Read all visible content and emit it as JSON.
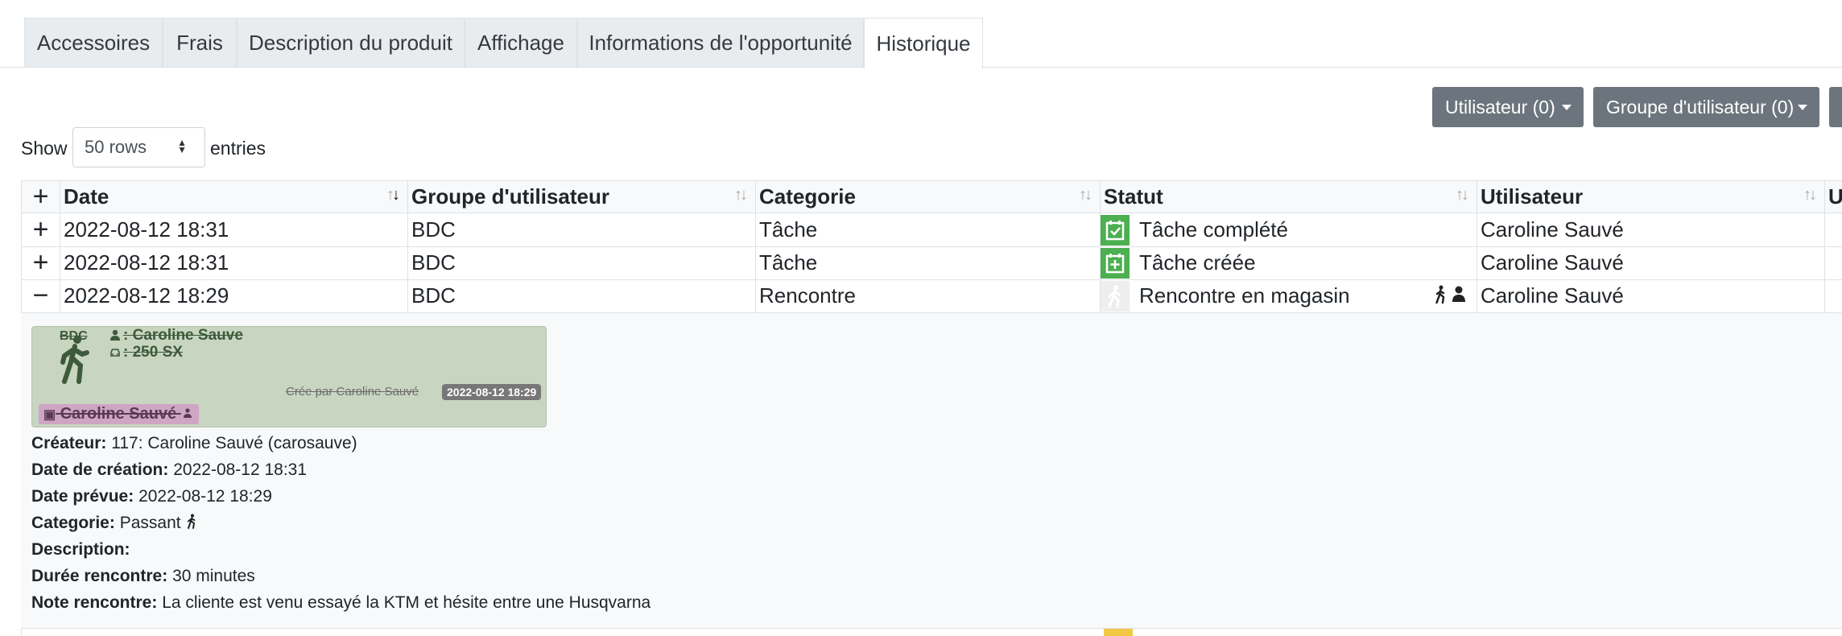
{
  "tabs": [
    {
      "label": "Accessoires"
    },
    {
      "label": "Frais"
    },
    {
      "label": "Description du produit"
    },
    {
      "label": "Affichage"
    },
    {
      "label": "Informations de l'opportunité"
    },
    {
      "label": "Historique",
      "active": true
    }
  ],
  "filters": {
    "user_button": "Utilisateur (0)",
    "group_button": "Groupe d'utilisateur (0)"
  },
  "length_menu": {
    "show_label": "Show",
    "selected": "50 rows",
    "entries_label": "entries"
  },
  "table": {
    "expand_header": "+",
    "columns": [
      "Date",
      "Groupe d'utilisateur",
      "Categorie",
      "Statut",
      "Utilisateur",
      "U"
    ],
    "rows": [
      {
        "toggle": "+",
        "date": "2022-08-12 18:31",
        "group": "BDC",
        "category": "Tâche",
        "status": "Tâche complété",
        "user": "Caroline Sauvé",
        "status_icon": "checkbox-checked-icon"
      },
      {
        "toggle": "+",
        "date": "2022-08-12 18:31",
        "group": "BDC",
        "category": "Tâche",
        "status": "Tâche créée",
        "user": "Caroline Sauvé",
        "status_icon": "plus-box-icon"
      },
      {
        "toggle": "−",
        "date": "2022-08-12 18:29",
        "group": "BDC",
        "category": "Rencontre",
        "status": "Rencontre en magasin",
        "user": "Caroline Sauvé",
        "status_icon": "walking-person-icon"
      }
    ]
  },
  "detail": {
    "card": {
      "group": "BDC",
      "contact": ": Caroline Sauve",
      "vehicle": ": 250 SX",
      "created_by": "Crée par Caroline Sauvé",
      "date_badge": "2022-08-12 18:29",
      "assignee": "Caroline Sauvé",
      "color": "#c8d5c0"
    },
    "lines": [
      {
        "label": "Créateur:",
        "value": "117: Caroline Sauvé (carosauve)"
      },
      {
        "label": "Date de création:",
        "value": "2022-08-12 18:31"
      },
      {
        "label": "Date prévue:",
        "value": "2022-08-12 18:29"
      },
      {
        "label": "Categorie:",
        "value": "Passant"
      },
      {
        "label": "Description:",
        "value": ""
      },
      {
        "label": "Durée rencontre:",
        "value": "30 minutes"
      },
      {
        "label": "Note rencontre:",
        "value": "La cliente est venu essayé la KTM et hésite entre une Husqvarna"
      }
    ]
  },
  "colors": {
    "status_green": "#4caf50",
    "button_grey": "#6c757d",
    "card_green": "#c8d5c0",
    "assignee_pink": "#cfa5c5"
  }
}
